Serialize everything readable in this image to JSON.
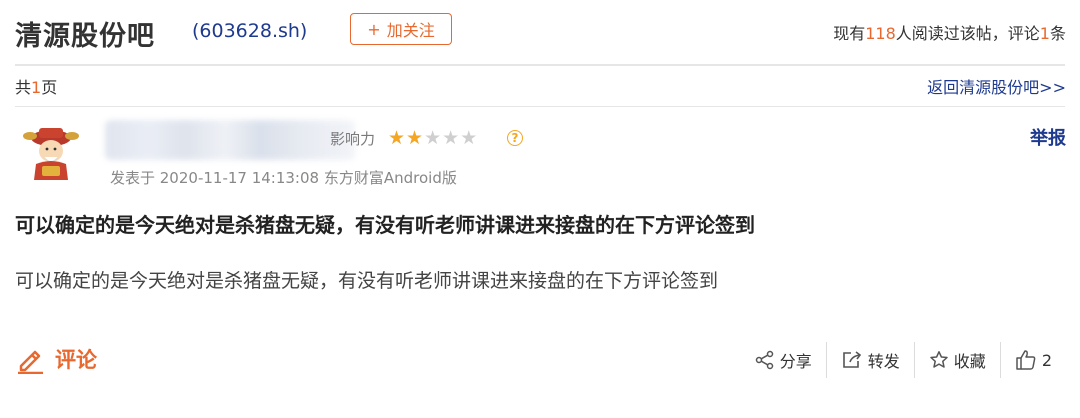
{
  "header": {
    "forum_name": "清源股份吧",
    "stock_code": "(603628.sh)",
    "follow_label": "加关注",
    "follow_plus": "+",
    "stats_prefix": "现有",
    "stats_readers": "118",
    "stats_middle": "人阅读过该帖，评论",
    "stats_comments": "1",
    "stats_suffix": "条"
  },
  "pager": {
    "prefix": "共",
    "total_pages": "1",
    "suffix": "页",
    "back_link": "返回清源股份吧>>"
  },
  "post": {
    "author_suffix": "影响力",
    "rating_filled": 2,
    "rating_total": 5,
    "help": "?",
    "meta": "发表于 2020-11-17 14:13:08 东方财富Android版",
    "report": "举报",
    "title": "可以确定的是今天绝对是杀猪盘无疑，有没有听老师讲课进来接盘的在下方评论签到",
    "body": "可以确定的是今天绝对是杀猪盘无疑，有没有听老师讲课进来接盘的在下方评论签到"
  },
  "footer": {
    "comment_label": "评论",
    "share_label": "分享",
    "forward_label": "转发",
    "favorite_label": "收藏",
    "like_count": "2"
  },
  "colors": {
    "accent": "#e8692f",
    "link": "#1e3a8f",
    "star": "#f5a623"
  }
}
